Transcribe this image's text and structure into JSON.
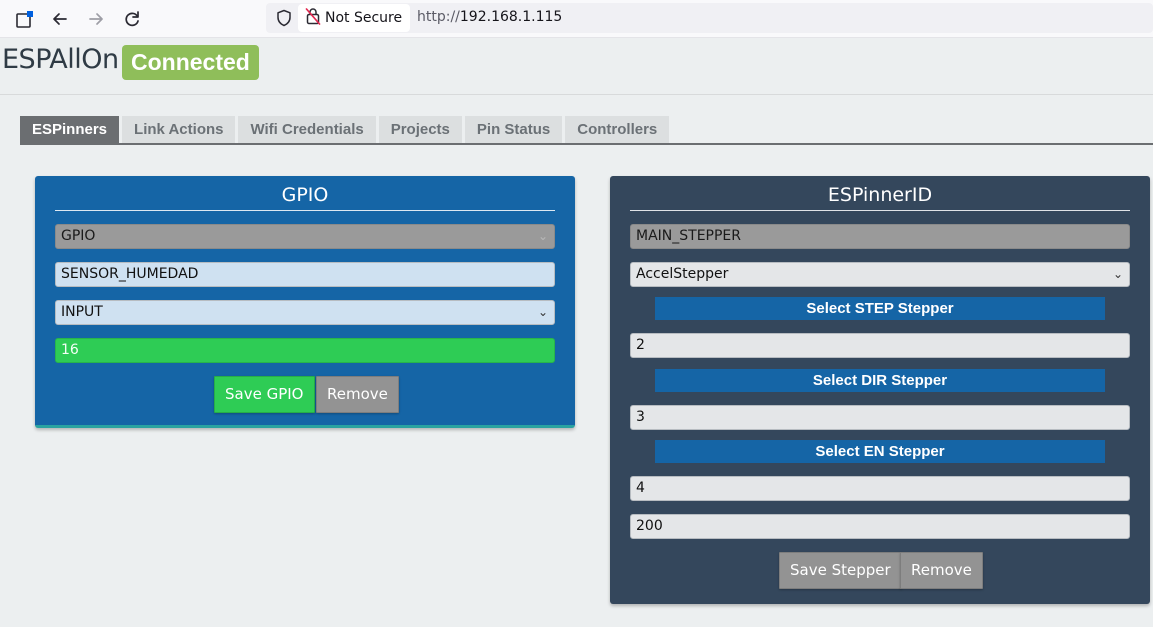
{
  "browser": {
    "security_label": "Not Secure",
    "url_scheme": "http://",
    "url_host": "192.168.1.115"
  },
  "app": {
    "brand": "ESPAllOn",
    "status_badge": "Connected",
    "accent_color": "#8fbe5a"
  },
  "tabs": [
    {
      "label": "ESPinners",
      "active": true
    },
    {
      "label": "Link Actions",
      "active": false
    },
    {
      "label": "Wifi Credentials",
      "active": false
    },
    {
      "label": "Projects",
      "active": false
    },
    {
      "label": "Pin Status",
      "active": false
    },
    {
      "label": "Controllers",
      "active": false
    }
  ],
  "gpio_panel": {
    "title": "GPIO",
    "type_select": "GPIO",
    "name_input": "SENSOR_HUMEDAD",
    "mode_select": "INPUT",
    "pin_input": "16",
    "save_label": "Save GPIO",
    "remove_label": "Remove"
  },
  "stepper_panel": {
    "title": "ESPinnerID",
    "id_input": "MAIN_STEPPER",
    "driver_select": "AccelStepper",
    "step_label": "Select STEP Stepper",
    "step_value": "2",
    "dir_label": "Select DIR Stepper",
    "dir_value": "3",
    "en_label": "Select EN Stepper",
    "en_value": "4",
    "speed_value": "200",
    "save_label": "Save Stepper",
    "remove_label": "Remove"
  }
}
